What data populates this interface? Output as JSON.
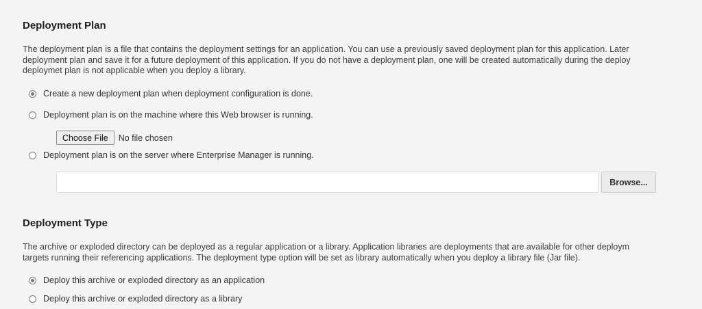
{
  "deployment_plan": {
    "title": "Deployment Plan",
    "description": [
      "The deployment plan is a file that contains the deployment settings for an application. You can use a previously saved deployment plan for this application. Later",
      "deployment plan and save it for a future deployment of this application. If you do not have a deployment plan, one will be created automatically during the deploy",
      "deploymet plan is not applicable when you deploy a library."
    ],
    "options": [
      {
        "label": "Create a new deployment plan when deployment configuration is done.",
        "selected": true
      },
      {
        "label": "Deployment plan is on the machine where this Web browser is running.",
        "selected": false
      },
      {
        "label": "Deployment plan is on the server where Enterprise Manager is running.",
        "selected": false
      }
    ],
    "file_picker": {
      "button_label": "Choose File",
      "status": "No file chosen"
    },
    "server_path": {
      "value": "",
      "browse_label": "Browse..."
    }
  },
  "deployment_type": {
    "title": "Deployment Type",
    "description": [
      "The archive or exploded directory can be deployed as a regular application or a library. Application libraries are deployments that are available for other deploym",
      "targets running their referencing applications. The deployment type option will be set as library automatically when you deploy a library file (Jar file)."
    ],
    "options": [
      {
        "label": "Deploy this archive or exploded directory as an application",
        "selected": true
      },
      {
        "label": "Deploy this archive or exploded directory as a library",
        "selected": false
      }
    ]
  }
}
